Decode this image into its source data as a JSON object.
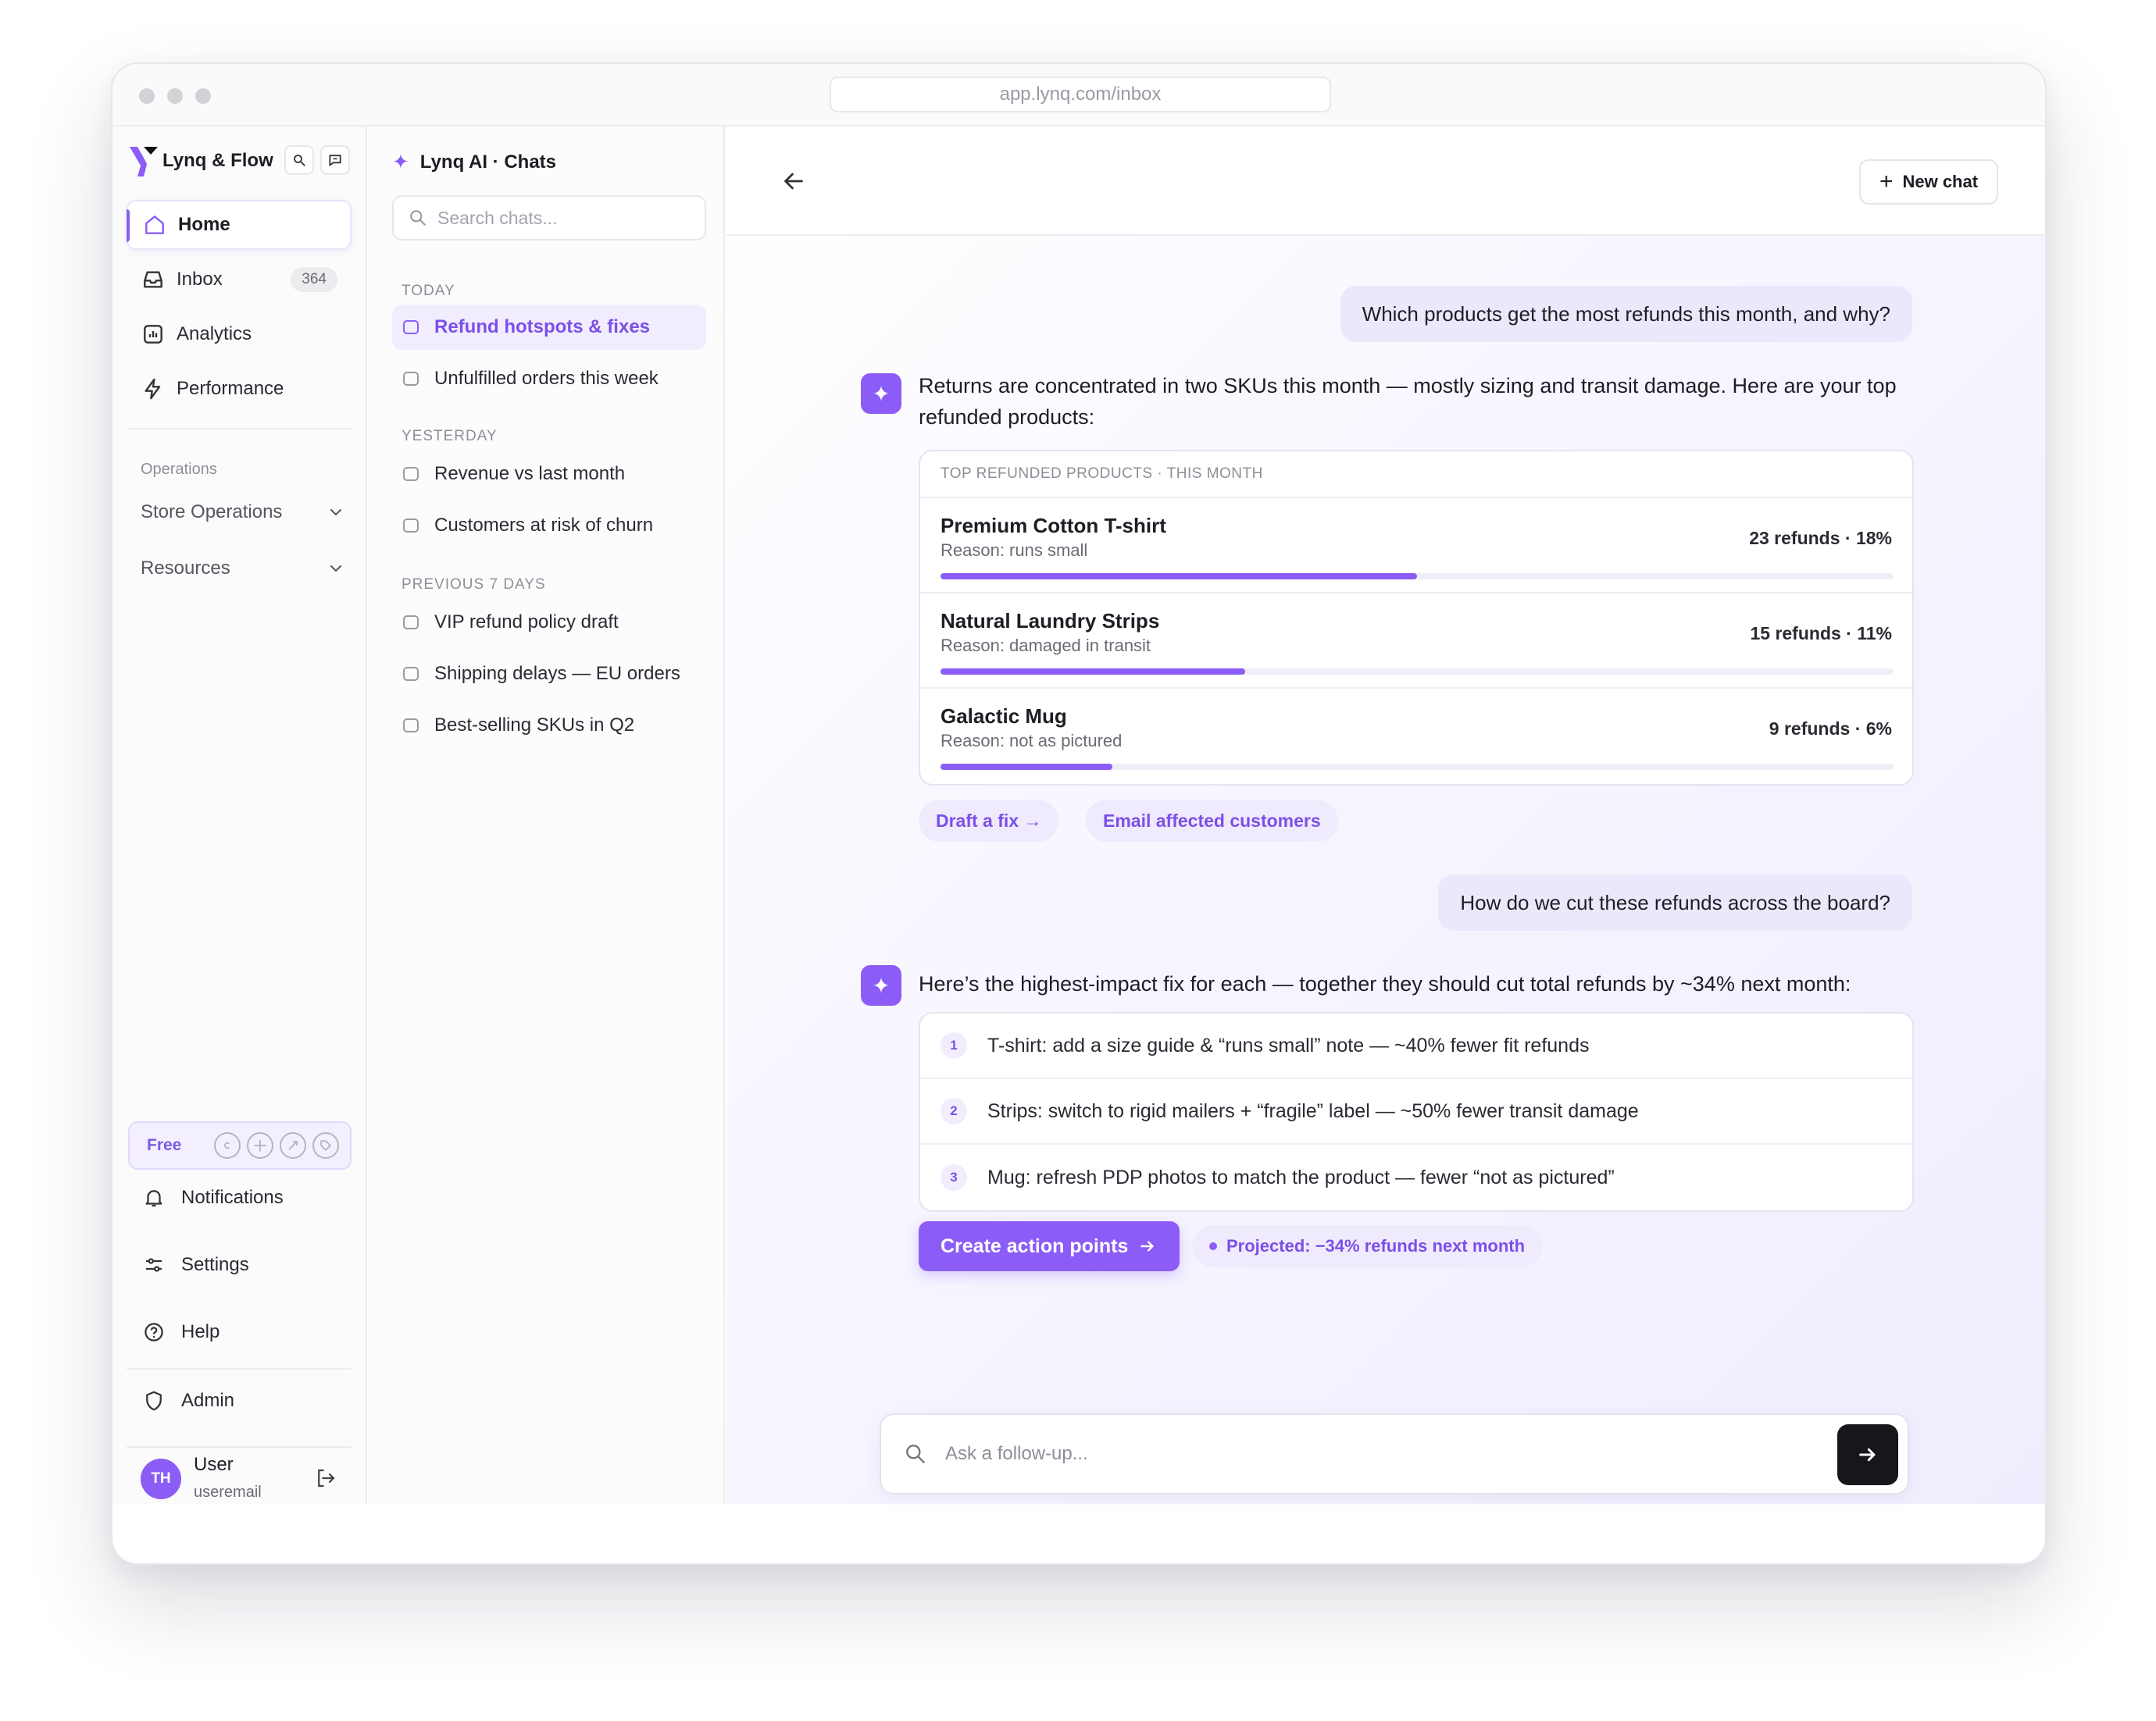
{
  "browser": {
    "url": "app.lynq.com/inbox"
  },
  "sidebar": {
    "brand": "Lynq & Flow",
    "nav": [
      {
        "label": "Home",
        "icon": "home-icon"
      },
      {
        "label": "Inbox",
        "icon": "inbox-icon",
        "badge": "364"
      },
      {
        "label": "Analytics",
        "icon": "analytics-icon"
      },
      {
        "label": "Performance",
        "icon": "bolt-icon"
      }
    ],
    "section_label": "Operations",
    "groups": [
      {
        "label": "Store Operations"
      },
      {
        "label": "Resources"
      }
    ],
    "plan": "Free",
    "bottom": [
      {
        "label": "Notifications",
        "icon": "bell-icon"
      },
      {
        "label": "Settings",
        "icon": "sliders-icon"
      },
      {
        "label": "Help",
        "icon": "help-icon"
      },
      {
        "label": "Admin",
        "icon": "shield-icon"
      }
    ],
    "user": {
      "initials": "TH",
      "name": "User",
      "email": "useremail"
    }
  },
  "chats": {
    "title": "Lynq AI · Chats",
    "search_placeholder": "Search chats...",
    "groups": [
      {
        "label": "TODAY",
        "items": [
          "Refund hotspots & fixes",
          "Unfulfilled orders this week"
        ]
      },
      {
        "label": "YESTERDAY",
        "items": [
          "Revenue vs last month",
          "Customers at risk of churn"
        ]
      },
      {
        "label": "PREVIOUS 7 DAYS",
        "items": [
          "VIP refund policy draft",
          "Shipping delays — EU orders",
          "Best-selling SKUs in Q2"
        ]
      }
    ]
  },
  "main": {
    "new_chat_label": "New chat",
    "q1": "Which products get the most refunds this month, and why?",
    "a1": "Returns are concentrated in two SKUs this month — mostly sizing and transit damage. Here are your top refunded products:",
    "table_title": "TOP REFUNDED PRODUCTS · THIS MONTH",
    "products": [
      {
        "name": "Premium Cotton T-shirt",
        "reason": "Reason: runs small",
        "stat": "23 refunds · 18%",
        "share": 0.5
      },
      {
        "name": "Natural Laundry Strips",
        "reason": "Reason: damaged in transit",
        "stat": "15 refunds · 11%",
        "share": 0.32
      },
      {
        "name": "Galactic Mug",
        "reason": "Reason: not as pictured",
        "stat": "9 refunds · 6%",
        "share": 0.18
      }
    ],
    "chips": [
      "Draft a fix →",
      "Email affected customers"
    ],
    "q2": "How do we cut these refunds across the board?",
    "a2": "Here’s the highest-impact fix for each — together they should cut total refunds by ~34% next month:",
    "fixes": [
      {
        "num": "1",
        "text": "T-shirt: add a size guide & “runs small” note — ~40% fewer fit refunds"
      },
      {
        "num": "2",
        "text": "Strips: switch to rigid mailers + “fragile” label — ~50% fewer transit damage"
      },
      {
        "num": "3",
        "text": "Mug: refresh PDP photos to match the product — fewer “not as pictured”"
      }
    ],
    "cta": "Create action points",
    "projected": "Projected: −34% refunds next month",
    "composer_placeholder": "Ask a follow-up..."
  },
  "colors": {
    "accent": "#8b5cf6",
    "accent_soft": "#efebfd",
    "send": "#16161b"
  }
}
